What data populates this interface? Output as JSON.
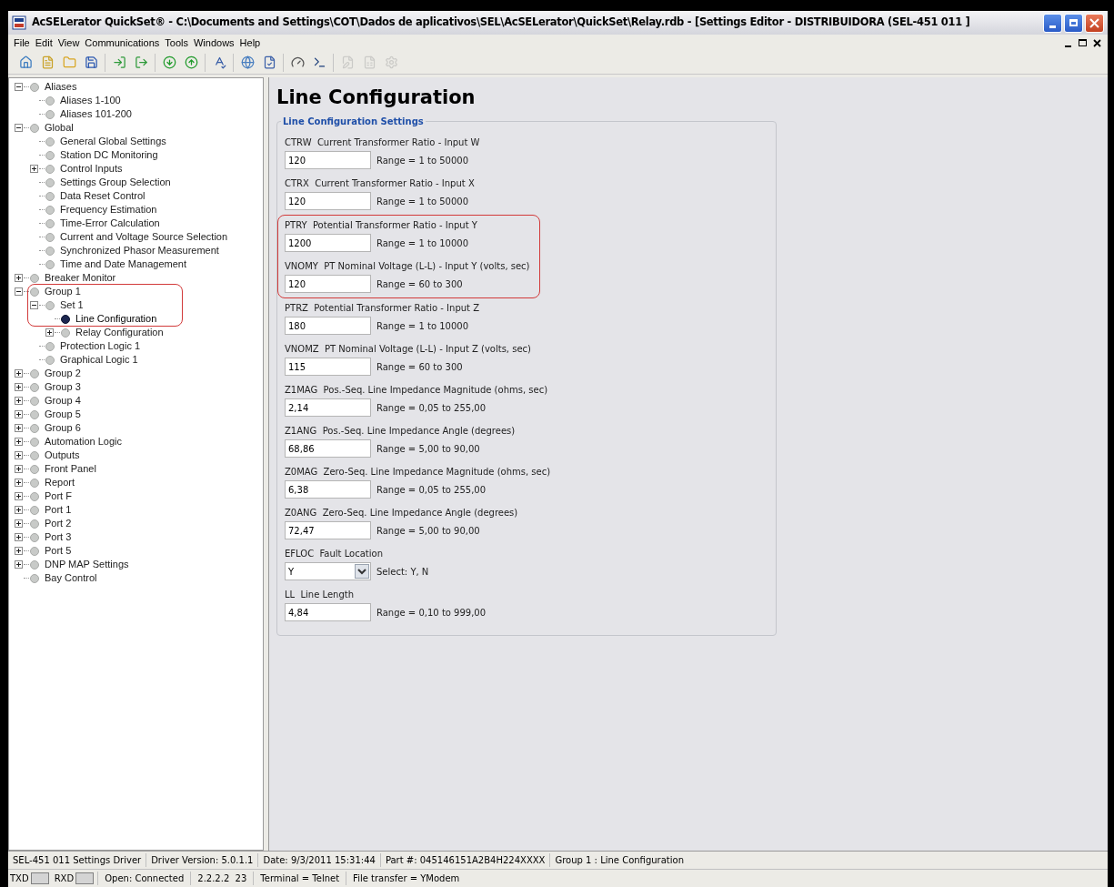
{
  "window": {
    "title": "AcSELerator QuickSet® - C:\\Documents and Settings\\COT\\Dados de aplicativos\\SEL\\AcSELerator\\QuickSet\\Relay.rdb - [Settings Editor - DISTRIBUIDORA (SEL-451 011 ]"
  },
  "menu": [
    "File",
    "Edit",
    "View",
    "Communications",
    "Tools",
    "Windows",
    "Help"
  ],
  "toolbar": [
    [
      {
        "disabled": false
      },
      {
        "disabled": false
      },
      {
        "disabled": false
      },
      {
        "disabled": false
      }
    ],
    [
      {
        "disabled": false
      },
      {
        "disabled": false
      }
    ],
    [
      {
        "disabled": false
      },
      {
        "disabled": false
      }
    ],
    [
      {
        "disabled": false
      }
    ],
    [
      {
        "disabled": false
      },
      {
        "disabled": false
      }
    ],
    [
      {
        "disabled": false
      },
      {
        "disabled": false
      }
    ],
    [
      {
        "disabled": true
      },
      {
        "disabled": true
      },
      {
        "disabled": true
      }
    ]
  ],
  "tree": [
    {
      "label": "Aliases",
      "expanded": true,
      "selected": false,
      "highlighted": false,
      "children": [
        {
          "label": "Aliases 1-100",
          "selected": false,
          "highlighted": false
        },
        {
          "label": "Aliases 101-200",
          "selected": false,
          "highlighted": false
        }
      ]
    },
    {
      "label": "Global",
      "expanded": true,
      "selected": false,
      "highlighted": false,
      "children": [
        {
          "label": "General Global Settings",
          "selected": false,
          "highlighted": false
        },
        {
          "label": "Station DC Monitoring",
          "selected": false,
          "highlighted": false
        },
        {
          "label": "Control Inputs",
          "expanded": false,
          "selected": false,
          "highlighted": false
        },
        {
          "label": "Settings Group Selection",
          "selected": false,
          "highlighted": false
        },
        {
          "label": "Data Reset Control",
          "selected": false,
          "highlighted": false
        },
        {
          "label": "Frequency Estimation",
          "selected": false,
          "highlighted": false
        },
        {
          "label": "Time-Error Calculation",
          "selected": false,
          "highlighted": false
        },
        {
          "label": "Current and Voltage Source Selection",
          "selected": false,
          "highlighted": false
        },
        {
          "label": "Synchronized Phasor Measurement",
          "selected": false,
          "highlighted": false
        },
        {
          "label": "Time and Date Management",
          "selected": false,
          "highlighted": false
        }
      ]
    },
    {
      "label": "Breaker Monitor",
      "expanded": false,
      "selected": false,
      "highlighted": false
    },
    {
      "label": "Group 1",
      "expanded": true,
      "selected": false,
      "highlighted": true,
      "children": [
        {
          "label": "Set 1",
          "expanded": true,
          "selected": false,
          "highlighted": true,
          "children": [
            {
              "label": "Line Configuration",
              "selected": true,
              "highlighted": true
            },
            {
              "label": "Relay Configuration",
              "expanded": false,
              "selected": false,
              "highlighted": false
            }
          ]
        },
        {
          "label": "Protection Logic 1",
          "selected": false,
          "highlighted": false
        },
        {
          "label": "Graphical Logic 1",
          "selected": false,
          "highlighted": false
        }
      ]
    },
    {
      "label": "Group 2",
      "expanded": false,
      "selected": false,
      "highlighted": false
    },
    {
      "label": "Group 3",
      "expanded": false,
      "selected": false,
      "highlighted": false
    },
    {
      "label": "Group 4",
      "expanded": false,
      "selected": false,
      "highlighted": false
    },
    {
      "label": "Group 5",
      "expanded": false,
      "selected": false,
      "highlighted": false
    },
    {
      "label": "Group 6",
      "expanded": false,
      "selected": false,
      "highlighted": false
    },
    {
      "label": "Automation Logic",
      "expanded": false,
      "selected": false,
      "highlighted": false
    },
    {
      "label": "Outputs",
      "expanded": false,
      "selected": false,
      "highlighted": false
    },
    {
      "label": "Front Panel",
      "expanded": false,
      "selected": false,
      "highlighted": false
    },
    {
      "label": "Report",
      "expanded": false,
      "selected": false,
      "highlighted": false
    },
    {
      "label": "Port F",
      "expanded": false,
      "selected": false,
      "highlighted": false
    },
    {
      "label": "Port 1",
      "expanded": false,
      "selected": false,
      "highlighted": false
    },
    {
      "label": "Port 2",
      "expanded": false,
      "selected": false,
      "highlighted": false
    },
    {
      "label": "Port 3",
      "expanded": false,
      "selected": false,
      "highlighted": false
    },
    {
      "label": "Port 5",
      "expanded": false,
      "selected": false,
      "highlighted": false
    },
    {
      "label": "DNP MAP Settings",
      "expanded": false,
      "selected": false,
      "highlighted": false
    },
    {
      "label": "Bay Control",
      "selected": false,
      "highlighted": false
    }
  ],
  "page": {
    "title": "Line Configuration",
    "group_title": "Line Configuration Settings",
    "fields": [
      {
        "kind": "text",
        "label": "CTRW  Current Transformer Ratio - Input W",
        "value": "120",
        "hint": "Range = 1 to 50000",
        "highlighted": false
      },
      {
        "kind": "text",
        "label": "CTRX  Current Transformer Ratio - Input X",
        "value": "120",
        "hint": "Range = 1 to 50000",
        "highlighted": false
      },
      {
        "kind": "text",
        "label": "PTRY  Potential Transformer Ratio - Input Y",
        "value": "1200",
        "hint": "Range = 1 to 10000",
        "highlighted": true
      },
      {
        "kind": "text",
        "label": "VNOMY  PT Nominal Voltage (L-L) - Input Y (volts, sec)",
        "value": "120",
        "hint": "Range = 60 to 300",
        "highlighted": true
      },
      {
        "kind": "text",
        "label": "PTRZ  Potential Transformer Ratio - Input Z",
        "value": "180",
        "hint": "Range = 1 to 10000",
        "highlighted": false
      },
      {
        "kind": "text",
        "label": "VNOMZ  PT Nominal Voltage (L-L) - Input Z (volts, sec)",
        "value": "115",
        "hint": "Range = 60 to 300",
        "highlighted": false
      },
      {
        "kind": "text",
        "label": "Z1MAG  Pos.-Seq. Line Impedance Magnitude (ohms, sec)",
        "value": "2,14",
        "hint": "Range = 0,05 to 255,00",
        "highlighted": false
      },
      {
        "kind": "text",
        "label": "Z1ANG  Pos.-Seq. Line Impedance Angle (degrees)",
        "value": "68,86",
        "hint": "Range = 5,00 to 90,00",
        "highlighted": false
      },
      {
        "kind": "text",
        "label": "Z0MAG  Zero-Seq. Line Impedance Magnitude (ohms, sec)",
        "value": "6,38",
        "hint": "Range = 0,05 to 255,00",
        "highlighted": false
      },
      {
        "kind": "text",
        "label": "Z0ANG  Zero-Seq. Line Impedance Angle (degrees)",
        "value": "72,47",
        "hint": "Range = 5,00 to 90,00",
        "highlighted": false
      },
      {
        "kind": "select",
        "label": "EFLOC  Fault Location",
        "value": "Y",
        "hint": "Select: Y, N",
        "highlighted": false
      },
      {
        "kind": "text",
        "label": "LL  Line Length",
        "value": "4,84",
        "hint": "Range = 0,10 to 999,00",
        "highlighted": false
      }
    ]
  },
  "status_bar": {
    "info": [
      "SEL-451 011 Settings Driver",
      "Driver Version: 5.0.1.1",
      "Date: 9/3/2011 15:31:44",
      "Part #: 045146151A2B4H224XXXX",
      "Group 1 : Line Configuration"
    ],
    "indicators": [
      {
        "label": "TXD",
        "on": false
      },
      {
        "label": "RXD",
        "on": false
      }
    ],
    "connection": [
      "Open: Connected",
      "2.2.2.2  23",
      "Terminal = Telnet",
      "File transfer = YModem"
    ]
  }
}
